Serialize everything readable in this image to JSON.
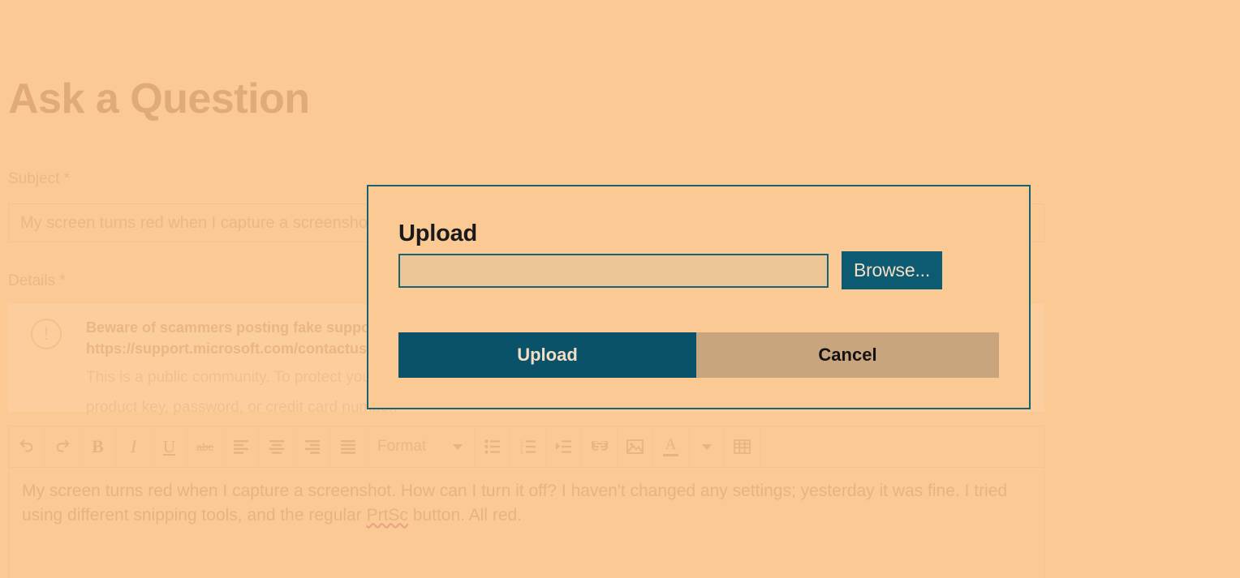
{
  "page": {
    "title": "Ask a Question",
    "subject": {
      "label": "Subject",
      "required_marker": "*",
      "placeholder": "My screen turns red when I capture a screenshot.",
      "value": ""
    },
    "details": {
      "label": "Details",
      "required_marker": "*"
    },
    "notice": {
      "icon": "alert-circle-icon",
      "glyph": "!",
      "strong_line_1": "Beware of scammers posting fake support numbers here.",
      "strong_line_2": "https://support.microsoft.com/contactus",
      "sub_line_1": "This is a public community. To protect your privacy, do not post any personal information such as your email address, phone number,",
      "sub_line_2": "product key, password, or credit card number."
    },
    "editor": {
      "toolbar": [
        {
          "name": "undo-icon",
          "label": "Undo",
          "glyph": "↶"
        },
        {
          "name": "redo-icon",
          "label": "Redo",
          "glyph": "↷"
        },
        {
          "name": "bold-icon",
          "label": "Bold",
          "glyph": "B"
        },
        {
          "name": "italic-icon",
          "label": "Italic",
          "glyph": "I"
        },
        {
          "name": "underline-icon",
          "label": "Underline",
          "glyph": "U"
        },
        {
          "name": "strikethrough-icon",
          "label": "Strikethrough",
          "glyph": "abc"
        },
        {
          "name": "align-left-icon",
          "label": "Align left",
          "glyph": ""
        },
        {
          "name": "align-center-icon",
          "label": "Align center",
          "glyph": ""
        },
        {
          "name": "align-right-icon",
          "label": "Align right",
          "glyph": ""
        },
        {
          "name": "align-justify-icon",
          "label": "Justify",
          "glyph": ""
        },
        {
          "name": "format-dropdown",
          "label": "Format",
          "glyph": ""
        },
        {
          "name": "bulleted-list-icon",
          "label": "Bulleted list",
          "glyph": ""
        },
        {
          "name": "numbered-list-icon",
          "label": "Numbered list",
          "glyph": ""
        },
        {
          "name": "indent-icon",
          "label": "Increase indent",
          "glyph": ""
        },
        {
          "name": "link-icon",
          "label": "Insert link",
          "glyph": ""
        },
        {
          "name": "image-icon",
          "label": "Insert image",
          "glyph": ""
        },
        {
          "name": "text-color-icon",
          "label": "Text color",
          "glyph": "A"
        },
        {
          "name": "color-dropdown-icon",
          "label": "Color options",
          "glyph": ""
        },
        {
          "name": "table-icon",
          "label": "Insert table",
          "glyph": ""
        }
      ],
      "format_label": "Format",
      "body_part_1": "My screen turns red when I capture a screenshot. How can I turn it off? I haven't changed any settings; yesterday it was fine. I tried using different snipping tools, and the regular ",
      "body_misspelled": "PrtSc",
      "body_part_2": " button. All red."
    }
  },
  "modal": {
    "title": "Upload",
    "file_input": {
      "value": "",
      "placeholder": ""
    },
    "browse_label": "Browse...",
    "upload_label": "Upload",
    "cancel_label": "Cancel"
  },
  "colors": {
    "background": "#fbc993",
    "modal_border": "#17636f",
    "accent_teal": "#0d5a73",
    "primary_button": "#0a516a",
    "secondary_button": "#c9a57e",
    "input_fill": "#edc596",
    "muted_text": "#e8b886",
    "spellcheck_underline": "#e8a285"
  }
}
